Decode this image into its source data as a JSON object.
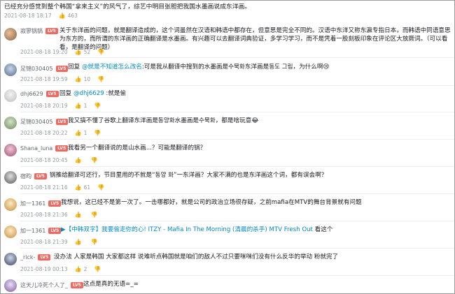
{
  "top": {
    "text": "已经充分感觉到整个韩国“拿来主义”的风气了，综艺中明目张胆把我国水墨画说成东洋画。",
    "date": "2021-08-18 18:17",
    "likes": "463"
  },
  "comments": [
    {
      "user": "寂寥锅锅",
      "level": "LV5",
      "text_line1": "关于东洋画的问题，就是翻译造成的，这个词虽然在汉语和韩语中都存在，但意思是完全不同的。汉语中东洋又称东瀛专指日本，而韩语中同语意思为东方的，而所谓的东洋画的正确翻译是水墨画。有兴趣可以去翻译词典验证，多学习学习，而不是凭着一股刻板印象在评论区大放厥词。（可以看看，是翻译的问题）",
      "date": "2021-08-18 19:20",
      "likes": "52"
    },
    {
      "user": "足锦030405",
      "level": "LV5",
      "reply_label": "回复",
      "reply_to": "@就是不知道怎么改名",
      "text": ":可是我从翻译中搜到的水墨画是수묵화东洋画是동도 그림，为什么啊",
      "emoji": "😢",
      "date": "2021-08-18 19:59",
      "likes": "10"
    },
    {
      "user": "dhj6629",
      "level": "LV5",
      "reply_label": "回复",
      "reply_to": "@dhj6629",
      "text": " :就是偷",
      "date": "2021-08-18 20:19",
      "likes": "1"
    },
    {
      "user": "足锦030405",
      "level": "LV5",
      "text": "我又搞不懂了谷歌上翻译东洋画是동양화水墨画是수묵화，都是啥玩意",
      "emoji": "😂",
      "date": "2021-08-18 20:22",
      "likes": "1"
    },
    {
      "user": "Shana_luna",
      "level": "LV5",
      "text": "我看另一个翻译说的是山水画...？可能是翻译的锅？",
      "date": "2021-08-18 20:45",
      "likes": ""
    },
    {
      "user": "宿昀",
      "level": "LV5",
      "text": "锅推给翻译可还行，节目里用的不就是“동양 화”一东洋画？大家不满的也是东洋画这个词，都有误会啊？",
      "date": "2021-08-18 21:16",
      "likes": "61"
    },
    {
      "user": "加一1361",
      "level": "LV5",
      "text": "我想说，这已经不是第一次了。一击哪都好，就是公司的政治立场很存疑，之前mafia在MTV的舞台背景就有问题",
      "date": "2021-08-18 21:36",
      "likes": ""
    },
    {
      "user": "加一1361",
      "level": "LV5",
      "link": "▶【中韩双字】我要偷走你的心! ITZY - Mafia In The Morning (清晨的杀手) MTV Fresh Out",
      "text": " 看这个",
      "date": "2021-08-18 21:39",
      "likes": ""
    },
    {
      "user": "_rick-",
      "level": "LV5",
      "text": "没办法 人家是韩国 大家都这样 说难听点韩国就是咱们的敌人不过只要咪咪们没有什么反华的举动 粉就完了",
      "date": "2021-08-19 00:13",
      "likes": "2"
    },
    {
      "user": "这天儿冷死个人了_",
      "level": "LV5",
      "text": "这点是真的无语=_=",
      "date": "",
      "likes": ""
    }
  ],
  "icons": {
    "like": "thumbs-up-icon",
    "dislike": "thumbs-down-icon"
  },
  "colors": {
    "level_badge": "#f0685f",
    "link": "#008ac5",
    "meta": "#9499a0"
  }
}
